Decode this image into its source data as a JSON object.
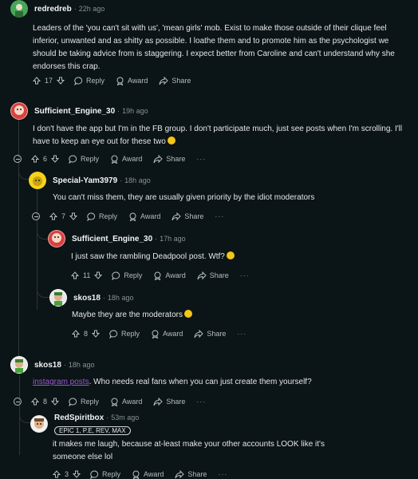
{
  "actions": {
    "reply": "Reply",
    "award": "Award",
    "share": "Share",
    "more": "···"
  },
  "comments": [
    {
      "author": "redredreb",
      "time": "22h ago",
      "body": "Leaders of the 'you can't sit with us', 'mean girls' mob. Exist to make those outside of their clique feel inferior, unwanted and as shitty as possible. I loathe them and to promote him as the psychologist we should be taking advice from is staggering. I expect better from Caroline and can't understand why she endorses this crap.",
      "votes": "17"
    },
    {
      "author": "Sufficient_Engine_30",
      "time": "19h ago",
      "body": "I don't have the app but I'm in the FB group. I don't participate much, just see posts when I'm scrolling. I'll have to keep an eye out for these two",
      "votes": "6"
    },
    {
      "author": "Special-Yam3979",
      "time": "18h ago",
      "body": "You can't miss them, they are usually given priority by the idiot moderators",
      "votes": "7"
    },
    {
      "author": "Sufficient_Engine_30",
      "time": "17h ago",
      "body": "I just saw the rambling Deadpool post. Wtf?",
      "votes": "11"
    },
    {
      "author": "skos18",
      "time": "18h ago",
      "body": "Maybe they are the moderators",
      "votes": "8"
    },
    {
      "author": "skos18",
      "time": "18h ago",
      "link": "instagram posts",
      "body": ". Who needs real fans when you can just create them yourself?",
      "votes": "8"
    },
    {
      "author": "RedSpiritbox",
      "time": "53m ago",
      "flair": "EPIC 1, P.E, REV, MAX",
      "body": "it makes me laugh, because at-least make your other accounts LOOK like it's someone else lol",
      "votes": "3"
    }
  ],
  "colors": {
    "background": "#0b1416",
    "link": "#9b59d1",
    "text": "#d7dadc"
  }
}
